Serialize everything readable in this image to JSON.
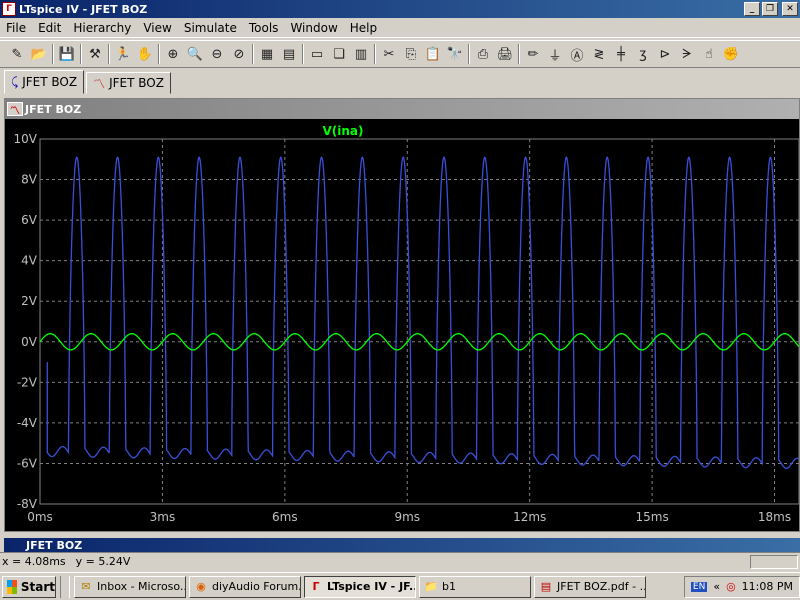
{
  "window": {
    "title": "LTspice IV - JFET BOZ",
    "app_icon": "ltspice-logo-icon",
    "buttons": [
      "minimize",
      "maximize",
      "close"
    ]
  },
  "menu": [
    "File",
    "Edit",
    "Hierarchy",
    "View",
    "Simulate",
    "Tools",
    "Window",
    "Help"
  ],
  "toolbar": {
    "icons": [
      "new-schematic-icon",
      "open-icon",
      "save-icon",
      "control-panel-icon",
      "run-icon",
      "halt-icon",
      "zoom-in-icon",
      "pan-icon",
      "zoom-out-icon",
      "zoom-fit-icon",
      "autorange-icon",
      "grid-icon",
      "tile-horizontal-icon",
      "cascade-icon",
      "tile-vertical-icon",
      "cut-icon",
      "copy-icon",
      "paste-icon",
      "find-icon",
      "print-preview-icon",
      "print-icon",
      "wire-icon",
      "ground-icon",
      "label-icon",
      "resistor-icon",
      "capacitor-icon",
      "inductor-icon",
      "diode-icon",
      "component-icon",
      "move-icon",
      "drag-icon"
    ]
  },
  "tabs": [
    {
      "label": "JFET BOZ",
      "icon": "schematic-icon"
    },
    {
      "label": "JFET BOZ",
      "icon": "waveform-icon"
    }
  ],
  "plot_window": {
    "title": "JFET BOZ"
  },
  "bottom_window": {
    "title": "JFET BOZ"
  },
  "status": {
    "x_readout": "x = 4.08ms",
    "y_readout": "y = 5.24V"
  },
  "chart_data": {
    "type": "line",
    "title": "V(ina)",
    "xlabel": "",
    "ylabel": "",
    "xlim": [
      0,
      18.6
    ],
    "ylim": [
      -8,
      10
    ],
    "x_ticks": [
      "0ms",
      "3ms",
      "6ms",
      "9ms",
      "12ms",
      "15ms",
      "18ms"
    ],
    "x_tick_values": [
      0,
      3,
      6,
      9,
      12,
      15,
      18
    ],
    "y_ticks": [
      "10V",
      "8V",
      "6V",
      "4V",
      "2V",
      "0V",
      "-2V",
      "-4V",
      "-6V",
      "-8V"
    ],
    "y_tick_values": [
      10,
      8,
      6,
      4,
      2,
      0,
      -2,
      -4,
      -6,
      -8
    ],
    "grid": true,
    "background": "#000000",
    "series": [
      {
        "name": "V(ina)",
        "color": "#00ff00",
        "period_ms": 1.0,
        "amplitude_v": 0.4,
        "offset_v": 0.0
      },
      {
        "name": "",
        "color": "#3a4fd8",
        "period_ms": 1.0,
        "peak_v": 9.1,
        "trough_v": -5.4,
        "trough_end_v": -6.0
      }
    ]
  },
  "taskbar": {
    "start_label": "Start",
    "tasks": [
      {
        "label": "Inbox - Microso...",
        "icon": "outlook-icon",
        "active": false
      },
      {
        "label": "diyAudio Forum...",
        "icon": "firefox-icon",
        "active": false
      },
      {
        "label": "LTspice IV - JF...",
        "icon": "ltspice-logo-icon",
        "active": true
      },
      {
        "label": "b1",
        "icon": "folder-icon",
        "active": false
      },
      {
        "label": "JFET BOZ.pdf - ...",
        "icon": "pdf-icon",
        "active": false
      }
    ],
    "tray_lang": "EN",
    "clock": "11:08 PM"
  },
  "colors": {
    "titlebar": "#0a246a",
    "plot_bg": "#000000",
    "grid": "#808080",
    "trace_green": "#00ff00",
    "trace_blue": "#3a4fd8",
    "axis_label": "#c0c0c0"
  }
}
